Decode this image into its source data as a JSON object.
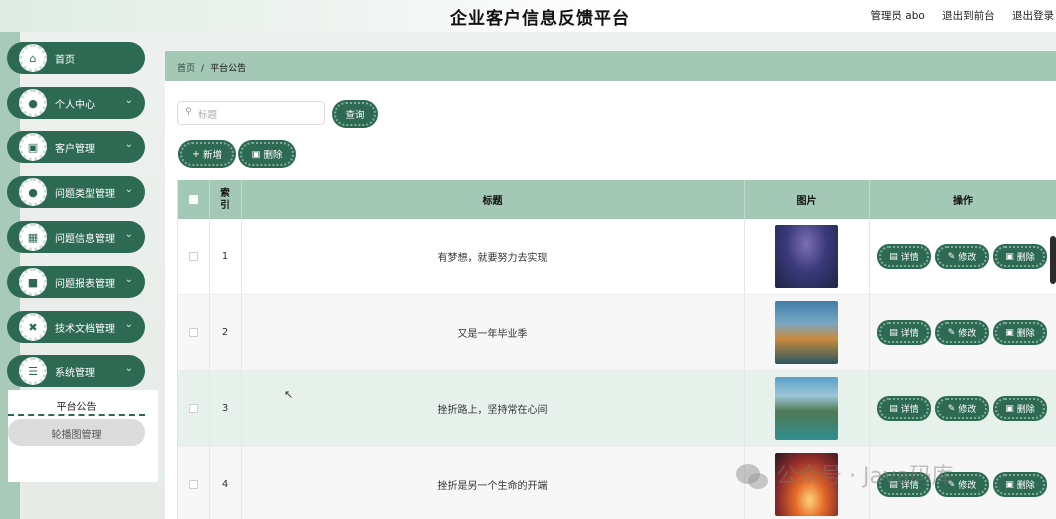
{
  "header": {
    "title": "企业客户信息反馈平台",
    "admin": "管理员 abo",
    "back_to_front": "退出到前台",
    "logout": "退出登录"
  },
  "sidebar": {
    "items": [
      {
        "label": "首页",
        "icon": "home-icon",
        "has_children": false
      },
      {
        "label": "个人中心",
        "icon": "user-icon",
        "has_children": true
      },
      {
        "label": "客户管理",
        "icon": "monitor-icon",
        "has_children": true
      },
      {
        "label": "问题类型管理",
        "icon": "person-icon",
        "has_children": true
      },
      {
        "label": "问题信息管理",
        "icon": "chart-icon",
        "has_children": true
      },
      {
        "label": "问题报表管理",
        "icon": "message-icon",
        "has_children": true
      },
      {
        "label": "技术文档管理",
        "icon": "code-icon",
        "has_children": true
      },
      {
        "label": "系统管理",
        "icon": "list-icon",
        "has_children": true
      }
    ],
    "submenu": {
      "active": "平台公告",
      "other": "轮播图管理"
    }
  },
  "breadcrumb": {
    "home": "首页",
    "separator": "/",
    "current": "平台公告"
  },
  "search": {
    "placeholder": "标题",
    "button": "查询"
  },
  "toolbar": {
    "add": "新增",
    "delete": "删除"
  },
  "table": {
    "headers": {
      "index": "索引",
      "title": "标题",
      "image": "图片",
      "actions": "操作"
    },
    "actions": {
      "detail": "详情",
      "edit": "修改",
      "delete": "删除"
    },
    "rows": [
      {
        "index": "1",
        "title": "有梦想，就要努力去实现"
      },
      {
        "index": "2",
        "title": "又是一年毕业季"
      },
      {
        "index": "3",
        "title": "挫折路上，坚持常在心间"
      },
      {
        "index": "4",
        "title": "挫折是另一个生命的开端"
      }
    ]
  },
  "watermark": "公众号 · Java码库",
  "colors": {
    "primary": "#2e6a53",
    "header_bar": "#a3c8b5",
    "sidebar_strip": "#a7cbb8"
  }
}
